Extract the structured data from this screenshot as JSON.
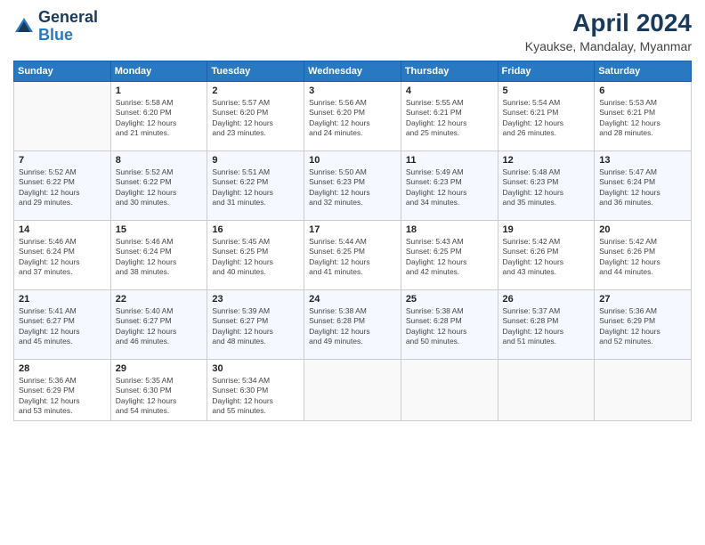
{
  "logo": {
    "line1": "General",
    "line2": "Blue"
  },
  "title": "April 2024",
  "location": "Kyaukse, Mandalay, Myanmar",
  "weekdays": [
    "Sunday",
    "Monday",
    "Tuesday",
    "Wednesday",
    "Thursday",
    "Friday",
    "Saturday"
  ],
  "weeks": [
    [
      {
        "day": "",
        "info": ""
      },
      {
        "day": "1",
        "info": "Sunrise: 5:58 AM\nSunset: 6:20 PM\nDaylight: 12 hours\nand 21 minutes."
      },
      {
        "day": "2",
        "info": "Sunrise: 5:57 AM\nSunset: 6:20 PM\nDaylight: 12 hours\nand 23 minutes."
      },
      {
        "day": "3",
        "info": "Sunrise: 5:56 AM\nSunset: 6:20 PM\nDaylight: 12 hours\nand 24 minutes."
      },
      {
        "day": "4",
        "info": "Sunrise: 5:55 AM\nSunset: 6:21 PM\nDaylight: 12 hours\nand 25 minutes."
      },
      {
        "day": "5",
        "info": "Sunrise: 5:54 AM\nSunset: 6:21 PM\nDaylight: 12 hours\nand 26 minutes."
      },
      {
        "day": "6",
        "info": "Sunrise: 5:53 AM\nSunset: 6:21 PM\nDaylight: 12 hours\nand 28 minutes."
      }
    ],
    [
      {
        "day": "7",
        "info": "Sunrise: 5:52 AM\nSunset: 6:22 PM\nDaylight: 12 hours\nand 29 minutes."
      },
      {
        "day": "8",
        "info": "Sunrise: 5:52 AM\nSunset: 6:22 PM\nDaylight: 12 hours\nand 30 minutes."
      },
      {
        "day": "9",
        "info": "Sunrise: 5:51 AM\nSunset: 6:22 PM\nDaylight: 12 hours\nand 31 minutes."
      },
      {
        "day": "10",
        "info": "Sunrise: 5:50 AM\nSunset: 6:23 PM\nDaylight: 12 hours\nand 32 minutes."
      },
      {
        "day": "11",
        "info": "Sunrise: 5:49 AM\nSunset: 6:23 PM\nDaylight: 12 hours\nand 34 minutes."
      },
      {
        "day": "12",
        "info": "Sunrise: 5:48 AM\nSunset: 6:23 PM\nDaylight: 12 hours\nand 35 minutes."
      },
      {
        "day": "13",
        "info": "Sunrise: 5:47 AM\nSunset: 6:24 PM\nDaylight: 12 hours\nand 36 minutes."
      }
    ],
    [
      {
        "day": "14",
        "info": "Sunrise: 5:46 AM\nSunset: 6:24 PM\nDaylight: 12 hours\nand 37 minutes."
      },
      {
        "day": "15",
        "info": "Sunrise: 5:46 AM\nSunset: 6:24 PM\nDaylight: 12 hours\nand 38 minutes."
      },
      {
        "day": "16",
        "info": "Sunrise: 5:45 AM\nSunset: 6:25 PM\nDaylight: 12 hours\nand 40 minutes."
      },
      {
        "day": "17",
        "info": "Sunrise: 5:44 AM\nSunset: 6:25 PM\nDaylight: 12 hours\nand 41 minutes."
      },
      {
        "day": "18",
        "info": "Sunrise: 5:43 AM\nSunset: 6:25 PM\nDaylight: 12 hours\nand 42 minutes."
      },
      {
        "day": "19",
        "info": "Sunrise: 5:42 AM\nSunset: 6:26 PM\nDaylight: 12 hours\nand 43 minutes."
      },
      {
        "day": "20",
        "info": "Sunrise: 5:42 AM\nSunset: 6:26 PM\nDaylight: 12 hours\nand 44 minutes."
      }
    ],
    [
      {
        "day": "21",
        "info": "Sunrise: 5:41 AM\nSunset: 6:27 PM\nDaylight: 12 hours\nand 45 minutes."
      },
      {
        "day": "22",
        "info": "Sunrise: 5:40 AM\nSunset: 6:27 PM\nDaylight: 12 hours\nand 46 minutes."
      },
      {
        "day": "23",
        "info": "Sunrise: 5:39 AM\nSunset: 6:27 PM\nDaylight: 12 hours\nand 48 minutes."
      },
      {
        "day": "24",
        "info": "Sunrise: 5:38 AM\nSunset: 6:28 PM\nDaylight: 12 hours\nand 49 minutes."
      },
      {
        "day": "25",
        "info": "Sunrise: 5:38 AM\nSunset: 6:28 PM\nDaylight: 12 hours\nand 50 minutes."
      },
      {
        "day": "26",
        "info": "Sunrise: 5:37 AM\nSunset: 6:28 PM\nDaylight: 12 hours\nand 51 minutes."
      },
      {
        "day": "27",
        "info": "Sunrise: 5:36 AM\nSunset: 6:29 PM\nDaylight: 12 hours\nand 52 minutes."
      }
    ],
    [
      {
        "day": "28",
        "info": "Sunrise: 5:36 AM\nSunset: 6:29 PM\nDaylight: 12 hours\nand 53 minutes."
      },
      {
        "day": "29",
        "info": "Sunrise: 5:35 AM\nSunset: 6:30 PM\nDaylight: 12 hours\nand 54 minutes."
      },
      {
        "day": "30",
        "info": "Sunrise: 5:34 AM\nSunset: 6:30 PM\nDaylight: 12 hours\nand 55 minutes."
      },
      {
        "day": "",
        "info": ""
      },
      {
        "day": "",
        "info": ""
      },
      {
        "day": "",
        "info": ""
      },
      {
        "day": "",
        "info": ""
      }
    ]
  ]
}
